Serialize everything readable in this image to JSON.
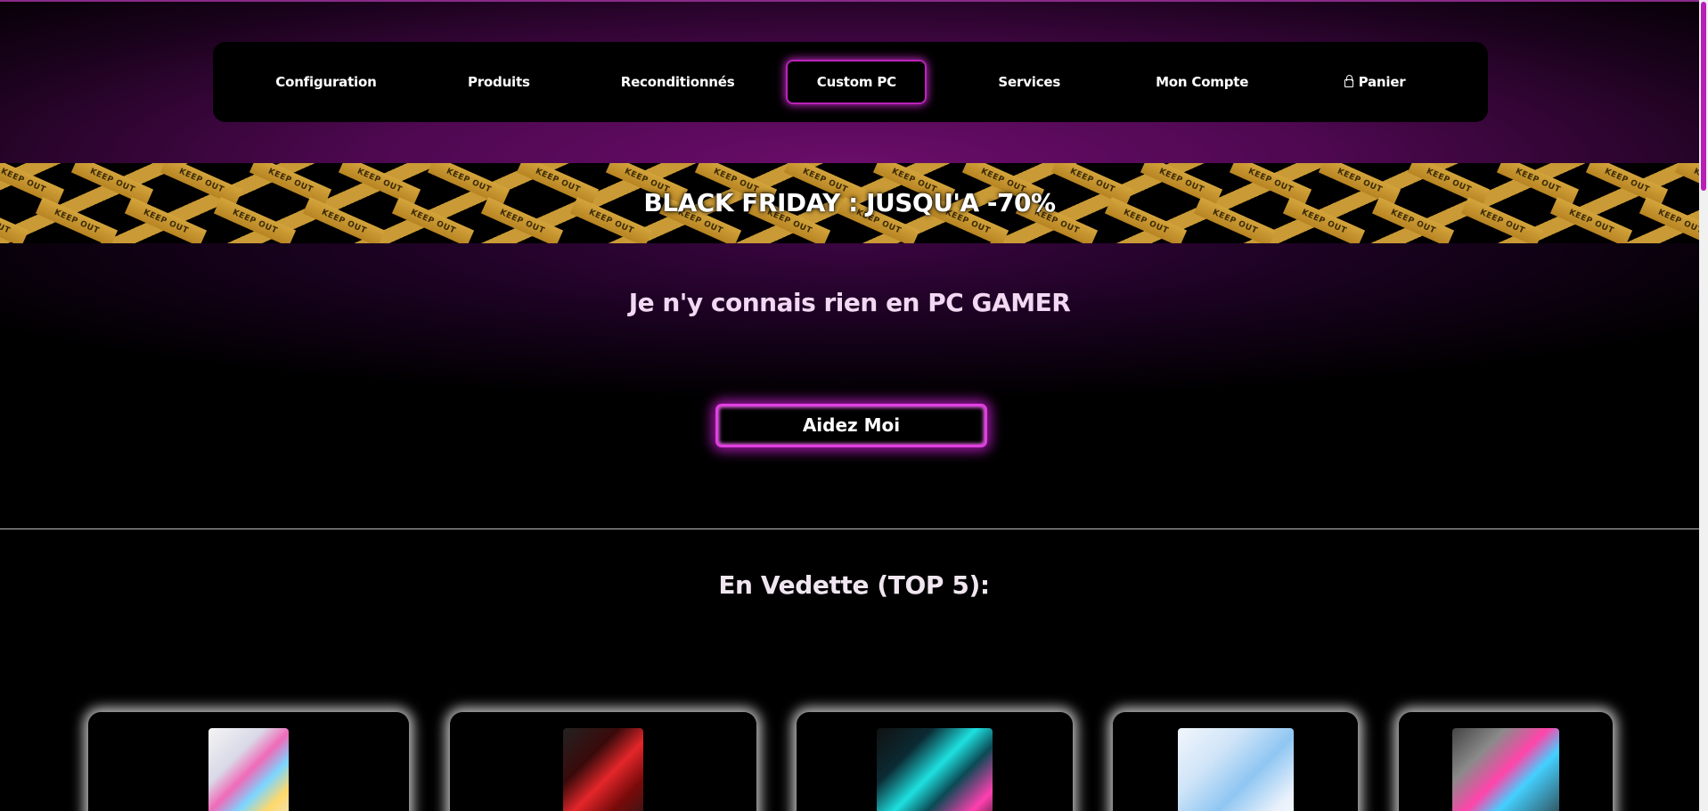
{
  "nav": {
    "items": [
      {
        "label": "Configuration"
      },
      {
        "label": "Produits"
      },
      {
        "label": "Reconditionnés"
      },
      {
        "label": "Custom PC"
      },
      {
        "label": "Services"
      },
      {
        "label": "Mon Compte"
      },
      {
        "label": "Panier"
      }
    ],
    "active": "Custom PC"
  },
  "promo": {
    "text": "BLACK FRIDAY : JUSQU'A -70%",
    "tape_text": "KEEP OUT"
  },
  "hero": {
    "title": "Je n'y connais rien en PC GAMER",
    "button_label": "Aidez Moi"
  },
  "featured": {
    "title": "En Vedette (TOP 5):"
  },
  "colors": {
    "accent": "#c226c2",
    "tape": "#c99a35",
    "background": "#000000"
  }
}
